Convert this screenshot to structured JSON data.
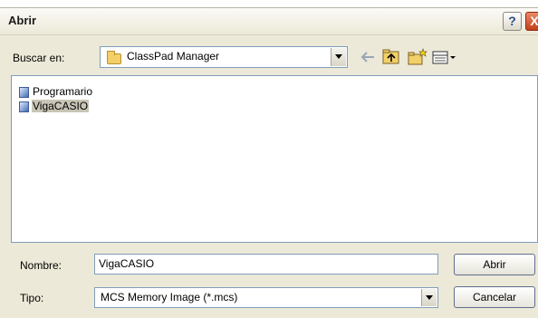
{
  "dialog": {
    "title": "Abrir",
    "help_button": "?",
    "close_button": "X"
  },
  "look_in": {
    "label": "Buscar en:",
    "value": "ClassPad Manager"
  },
  "files": [
    {
      "name": "Programario",
      "selected": false
    },
    {
      "name": "VigaCASIO",
      "selected": true
    }
  ],
  "file_name": {
    "label": "Nombre:",
    "value": "VigaCASIO"
  },
  "file_type": {
    "label": "Tipo:",
    "value": "MCS Memory Image (*.mcs)"
  },
  "buttons": {
    "open": "Abrir",
    "cancel": "Cancelar"
  },
  "icons": [
    "folder-icon",
    "back-arrow-icon",
    "up-folder-icon",
    "new-folder-icon",
    "view-menu-icon",
    "file-icon"
  ],
  "colors": {
    "dialog_bg": "#ece9d8",
    "field_border": "#7f9db9",
    "close_button": "#c2401a",
    "selection": "#c9c5b6"
  }
}
